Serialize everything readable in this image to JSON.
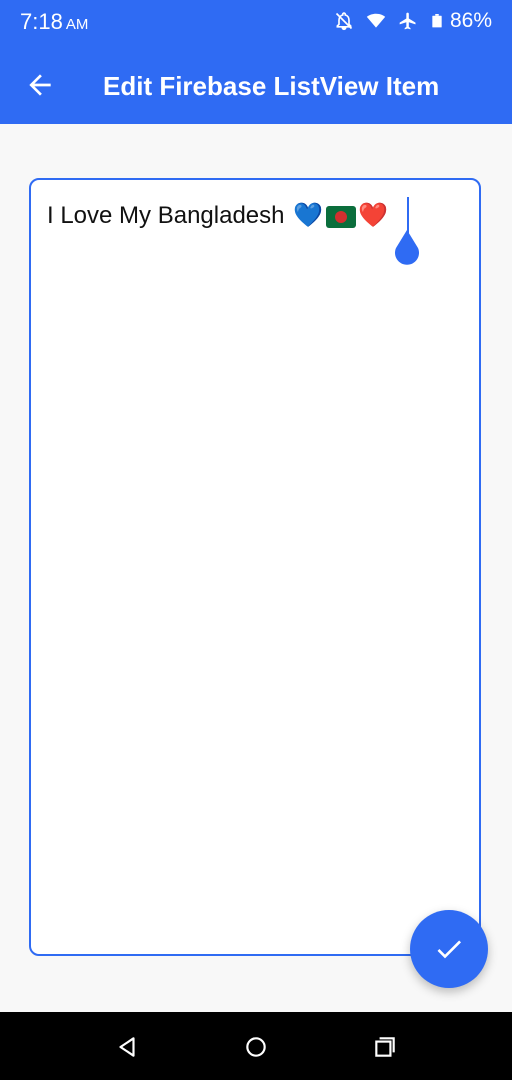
{
  "status_bar": {
    "time": "7:18",
    "ampm": "AM",
    "battery": "86%",
    "icons": [
      "notifications-off-icon",
      "wifi-icon",
      "airplane-icon",
      "battery-icon"
    ]
  },
  "app_bar": {
    "title": "Edit Firebase ListView Item",
    "back_icon": "arrow-back-icon"
  },
  "editor": {
    "text": "I Love My Bangladesh",
    "emoji_blue_heart": "💙",
    "emoji_flag": "bangladesh-flag",
    "emoji_red_heart": "❤️"
  },
  "fab": {
    "icon": "check-icon"
  },
  "nav_bar": {
    "icons": [
      "back-icon",
      "home-icon",
      "recents-icon"
    ]
  },
  "colors": {
    "primary": "#2f6bf3",
    "background": "#f8f8f8",
    "nav": "#000000"
  }
}
